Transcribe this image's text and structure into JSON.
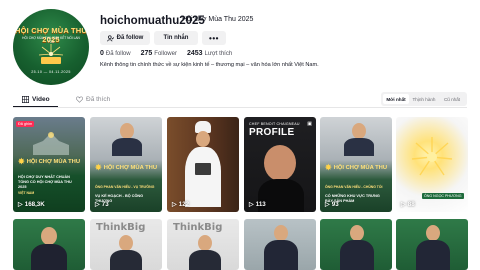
{
  "profile": {
    "avatar_title": "HỘI CHỢ MÙA THU 2025",
    "avatar_subtitle": "HỘI CHỢ MÙA THU 2025 KẾT NỐI LAN TỎA",
    "avatar_dates": "25.10 — 04.11.2025",
    "username": "hoichomuathu2025",
    "nickname": "Hội chợ Mùa Thu 2025",
    "follow_label": "Đã follow",
    "message_label": "Tin nhắn",
    "more_label": "•••",
    "stats": {
      "following_count": "0",
      "following_label": "Đã follow",
      "followers_count": "275",
      "followers_label": "Follower",
      "likes_count": "2453",
      "likes_label": "Lượt thích"
    },
    "bio": "Kênh thông tin chính thức về sự kiện kinh tế – thương mại – văn hóa lớn nhất Việt Nam."
  },
  "tabs": {
    "videos_label": "Video",
    "liked_label": "Đã thích"
  },
  "sort": {
    "newest": "Mới nhất",
    "popular": "Thịnh hành",
    "oldest": "Cũ nhất"
  },
  "videos": [
    {
      "views": "168,3K",
      "pinned_label": "Đã ghim",
      "logo": "HỘI CHỢ MÙA THU",
      "caption": "HỘI CHỢ DUY NHẤT CHUẨN TỔNG CỔ HỘI CHỢ MÙA THU 2025",
      "caption2": "VIỆT NAM"
    },
    {
      "views": "73",
      "logo": "HỘI CHỢ MÙA THU",
      "caption": "ÔNG PHAN VĂN HIẾU - VỤ TRƯỞNG",
      "caption2": "VỤ KẾ HOẠCH - BỘ CÔNG THƯƠNG"
    },
    {
      "views": "122"
    },
    {
      "views": "113",
      "chef_name": "CHEF BENOIT CHAIGNEAU",
      "profile_word": "PROFILE"
    },
    {
      "views": "93",
      "logo": "HỘI CHỢ MÙA THU",
      "caption": "ÔNG PHAN VĂN HIẾU - CHỦNG TỐI",
      "caption2": "CÓ NHỮNG KHU VỰC TRƯNG BÀY SẢN PHẨM"
    },
    {
      "views": "88",
      "caption": "ÔNG NGỌC PHƯƠNG"
    },
    {
      "views": ""
    },
    {
      "views": "",
      "think": "ThinkBig"
    },
    {
      "views": "",
      "think": "ThinkBig"
    },
    {
      "views": ""
    },
    {
      "views": ""
    },
    {
      "views": ""
    }
  ],
  "colors": {
    "brand_green": "#17602f",
    "accent_gold": "#ffe07a",
    "pinned_red": "#fe2c55"
  }
}
